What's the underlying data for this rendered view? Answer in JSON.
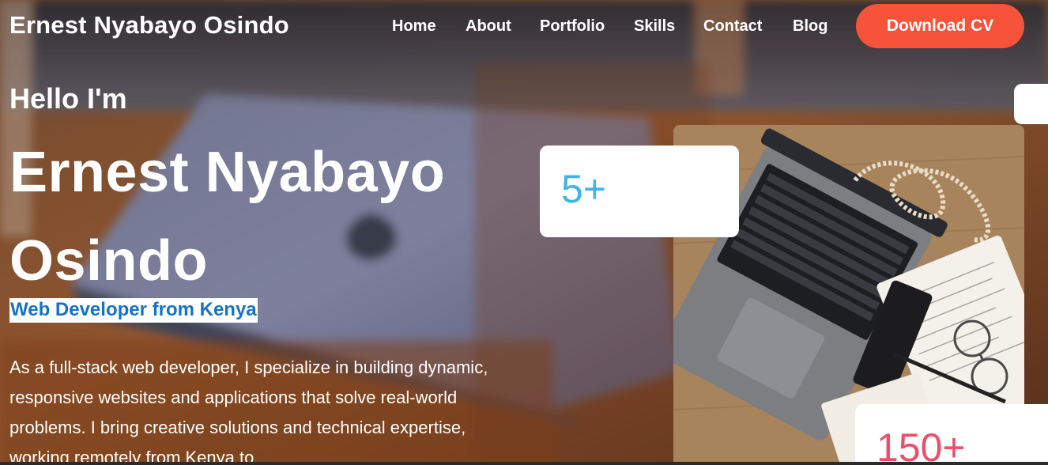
{
  "brand": "Ernest Nyabayo Osindo",
  "nav": {
    "items": [
      {
        "label": "Home"
      },
      {
        "label": "About"
      },
      {
        "label": "Portfolio"
      },
      {
        "label": "Skills"
      },
      {
        "label": "Contact"
      },
      {
        "label": "Blog"
      }
    ],
    "cv_button": "Download CV"
  },
  "hero": {
    "greeting": "Hello I'm",
    "name": "Ernest Nyabayo Osindo",
    "role": "Web Developer from Kenya",
    "bio": "As a full-stack web developer, I specialize in building dynamic, responsive websites and applications that solve real-world problems. I bring creative solutions and technical expertise, working remotely from Kenya to"
  },
  "stats": {
    "years": "5+",
    "projects": "150+"
  },
  "colors": {
    "accent_button": "#f7523a",
    "role_text": "#1672c9",
    "stat_years": "#3eb4e8",
    "stat_projects": "#ea4f6c"
  }
}
